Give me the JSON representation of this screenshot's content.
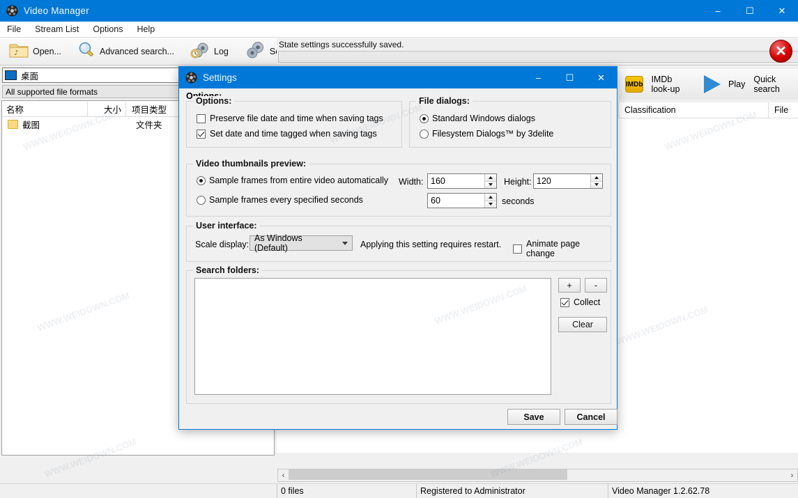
{
  "main_window": {
    "title": "Video Manager",
    "title_icon": "film-reel-icon",
    "controls": {
      "minimize": "–",
      "maximize": "☐",
      "close": "✕"
    },
    "menu": [
      "File",
      "Stream List",
      "Options",
      "Help"
    ],
    "toolbar": [
      {
        "label": "Open...",
        "icon": "open-folder-icon"
      },
      {
        "label": "Advanced search...",
        "icon": "magnifier-icon"
      },
      {
        "label": "Log",
        "icon": "gears-clock-icon"
      },
      {
        "label": "Settings...",
        "icon": "gears-icon"
      }
    ],
    "status_message": "State settings successfully saved.",
    "error_icon": "red-error-icon",
    "address_bar": {
      "label": "桌面",
      "icon": "desktop-icon"
    },
    "filter_bar": "All supported file formats",
    "file_columns": [
      "名称",
      "大小",
      "项目类型"
    ],
    "file_rows": [
      {
        "name": "截图",
        "size": "",
        "type": "文件夹",
        "icon": "folder-icon"
      }
    ],
    "right_toolbar": [
      {
        "label": "IMDb look-up",
        "icon": "imdb-icon",
        "badge": "IMDb"
      },
      {
        "label": "Play",
        "icon": "play-icon"
      },
      {
        "label": "Quick search",
        "icon": "quick-search-icon"
      }
    ],
    "right_columns": [
      "Classification",
      "File"
    ],
    "scrollbar": {
      "left_arrow": "‹",
      "right_arrow": "›"
    },
    "statusbar": {
      "files": "0 files",
      "registration": "Registered to Administrator",
      "version": "Video Manager 1.2.62.78"
    }
  },
  "settings_dialog": {
    "title": "Settings",
    "title_icon": "film-reel-icon",
    "controls": {
      "minimize": "–",
      "maximize": "☐",
      "close": "✕"
    },
    "outer_label": "Options:",
    "options_group": {
      "title": "Options:",
      "items": [
        {
          "label": "Preserve file date and time when saving tags",
          "checked": false
        },
        {
          "label": "Set date and time tagged when saving tags",
          "checked": true
        }
      ]
    },
    "file_dialogs_group": {
      "title": "File dialogs:",
      "items": [
        {
          "label": "Standard Windows dialogs",
          "selected": true
        },
        {
          "label": "Filesystem Dialogs™ by 3delite",
          "selected": false
        }
      ]
    },
    "thumbnails_group": {
      "title": "Video thumbnails preview:",
      "radios": [
        {
          "label": "Sample frames from entire video automatically",
          "selected": true
        },
        {
          "label": "Sample frames every specified seconds",
          "selected": false
        }
      ],
      "width_label": "Width:",
      "width_value": "160",
      "height_label": "Height:",
      "height_value": "120",
      "seconds_value": "60",
      "seconds_label": "seconds"
    },
    "ui_group": {
      "title": "User interface:",
      "scale_label": "Scale display:",
      "scale_value": "As Windows (Default)",
      "scale_options": [
        "As Windows (Default)"
      ],
      "restart_note": "Applying this setting requires restart.",
      "animate_label": "Animate page change",
      "animate_checked": false
    },
    "search_folders_group": {
      "title": "Search folders:",
      "list_items": [],
      "add_button": "+",
      "remove_button": "-",
      "collect_label": "Collect",
      "collect_checked": true,
      "clear_button": "Clear"
    },
    "footer": {
      "save": "Save",
      "cancel": "Cancel"
    }
  },
  "watermarks": [
    "WWW.WEIDOWN.COM",
    "WWW.WEIDOWN.COM",
    "WWW.WEIDOWN.COM",
    "WWW.WEIDOWN.COM",
    "WWW.WEIDOWN.COM",
    "WWW.WEIDOWN.COM",
    "WWW.WEIDOWN.COM",
    "WWW.WEIDOWN.COM"
  ],
  "colors": {
    "accent": "#0078d7",
    "error": "#d60000",
    "dialog_bg": "#f0f0f0",
    "imdb": "#f7c600"
  }
}
